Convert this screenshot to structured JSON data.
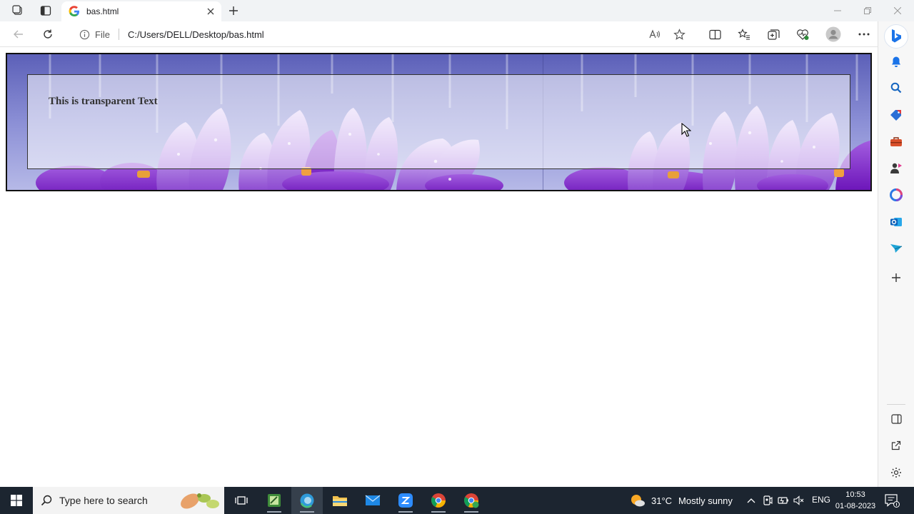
{
  "browser": {
    "tab": {
      "title": "bas.html"
    },
    "address": {
      "scheme_label": "File",
      "url": "C:/Users/DELL/Desktop/bas.html"
    }
  },
  "page": {
    "transparent_text": "This is transparent Text"
  },
  "taskbar": {
    "search_placeholder": "Type here to search",
    "weather": {
      "temperature": "31°C",
      "description": "Mostly sunny"
    },
    "language": "ENG",
    "clock": {
      "time": "10:53",
      "date": "01-08-2023"
    }
  },
  "colors": {
    "banner_purple": "#6f71c4",
    "taskbar_bg": "#1c2530",
    "edge_blue": "#0a66c2"
  },
  "icons": {
    "sidebar": [
      "bell-icon",
      "search-icon",
      "tag-icon",
      "toolbox-icon",
      "games-icon",
      "office-icon",
      "outlook-icon",
      "send-icon",
      "plus-icon",
      "split-window-icon",
      "external-link-icon",
      "gear-icon"
    ]
  }
}
